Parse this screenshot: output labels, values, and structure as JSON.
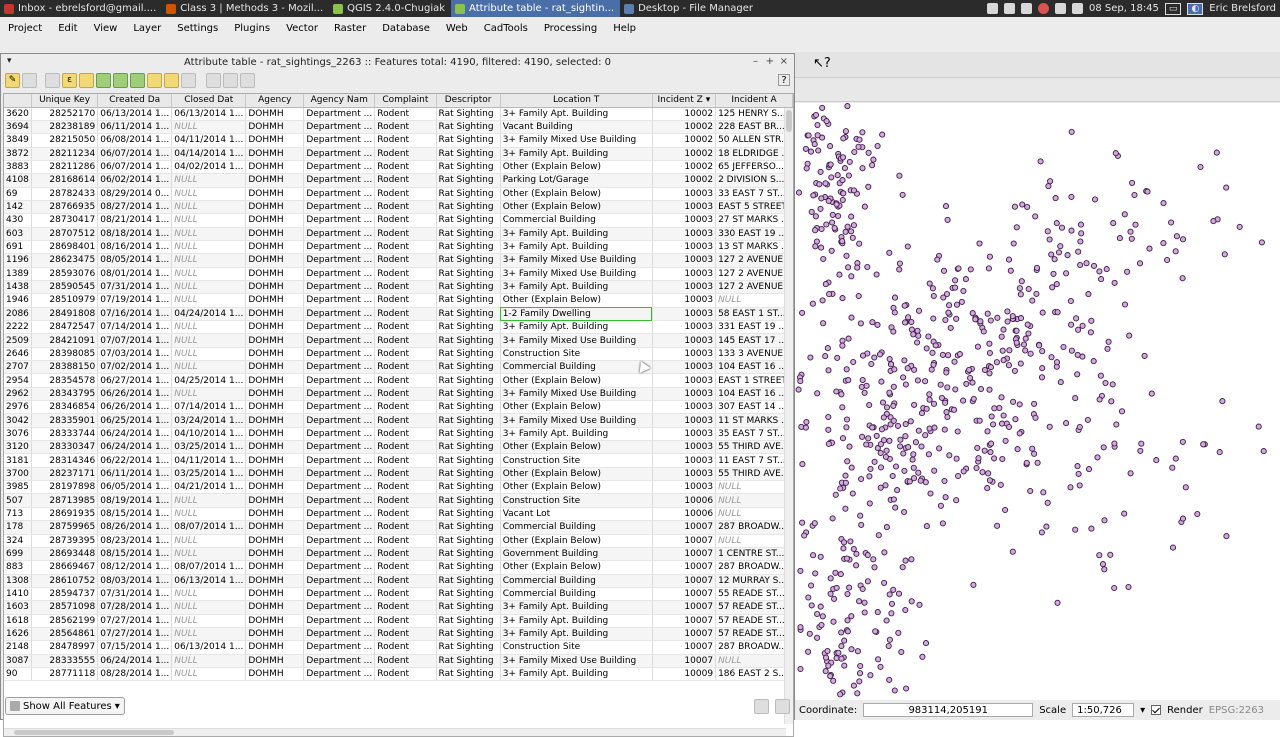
{
  "taskbar": {
    "tasks": [
      {
        "label": "Inbox - ebrelsford@gmail....",
        "color": "#c0392b"
      },
      {
        "label": "Class 3 | Methods 3 - Mozil...",
        "color": "#d35400"
      },
      {
        "label": "QGIS 2.4.0-Chugiak",
        "color": "#8bc34a"
      },
      {
        "label": "Attribute table - rat_sightin...",
        "color": "#8bc34a"
      },
      {
        "label": "Desktop - File Manager",
        "color": "#5b7fb0"
      }
    ],
    "clock": "08 Sep, 18:45",
    "user": "Eric Brelsford"
  },
  "menubar": [
    "Project",
    "Edit",
    "View",
    "Layer",
    "Settings",
    "Plugins",
    "Vector",
    "Raster",
    "Database",
    "Web",
    "CadTools",
    "Processing",
    "Help"
  ],
  "dialog": {
    "title": "Attribute table - rat_sightings_2263 :: Features total: 4190, filtered: 4190, selected: 0",
    "controls": {
      "minimize": "–",
      "maximize": "+",
      "close": "×",
      "help": "?"
    },
    "show_all_label": "Show All Features"
  },
  "table": {
    "columns": [
      "Unique Key",
      "Created Da",
      "Closed Dat",
      "Agency",
      "Agency Nam",
      "Complaint",
      "Descriptor",
      "Location T",
      "Incident Z",
      "Incident A"
    ],
    "rows": [
      [
        "3620",
        "28252170",
        "06/13/2014 1...",
        "06/13/2014 1...",
        "DOHMH",
        "Department ...",
        "Rodent",
        "Rat Sighting",
        "3+ Family Apt. Building",
        "10002",
        "125 HENRY S..."
      ],
      [
        "3694",
        "28238189",
        "06/11/2014 1...",
        "NULL",
        "DOHMH",
        "Department ...",
        "Rodent",
        "Rat Sighting",
        "Vacant Building",
        "10002",
        "228 EAST BR..."
      ],
      [
        "3849",
        "28215050",
        "06/08/2014 1...",
        "04/11/2014 1...",
        "DOHMH",
        "Department ...",
        "Rodent",
        "Rat Sighting",
        "3+ Family Mixed Use Building",
        "10002",
        "50 ALLEN STR..."
      ],
      [
        "3872",
        "28211234",
        "06/07/2014 1...",
        "04/14/2014 1...",
        "DOHMH",
        "Department ...",
        "Rodent",
        "Rat Sighting",
        "3+ Family Apt. Building",
        "10002",
        "18 ELDRIDGE ..."
      ],
      [
        "3883",
        "28211286",
        "06/07/2014 1...",
        "04/02/2014 1...",
        "DOHMH",
        "Department ...",
        "Rodent",
        "Rat Sighting",
        "Other (Explain Below)",
        "10002",
        "65 JEFFERSO..."
      ],
      [
        "4108",
        "28168614",
        "06/02/2014 1...",
        "NULL",
        "DOHMH",
        "Department ...",
        "Rodent",
        "Rat Sighting",
        "Parking Lot/Garage",
        "10002",
        "2 DIVISION S..."
      ],
      [
        "69",
        "28782433",
        "08/29/2014 0...",
        "NULL",
        "DOHMH",
        "Department ...",
        "Rodent",
        "Rat Sighting",
        "Other (Explain Below)",
        "10003",
        "33 EAST 7 ST..."
      ],
      [
        "142",
        "28766935",
        "08/27/2014 1...",
        "NULL",
        "DOHMH",
        "Department ...",
        "Rodent",
        "Rat Sighting",
        "Other (Explain Below)",
        "10003",
        "EAST 5 STREET"
      ],
      [
        "430",
        "28730417",
        "08/21/2014 1...",
        "NULL",
        "DOHMH",
        "Department ...",
        "Rodent",
        "Rat Sighting",
        "Commercial Building",
        "10003",
        "27 ST MARKS ..."
      ],
      [
        "603",
        "28707512",
        "08/18/2014 1...",
        "NULL",
        "DOHMH",
        "Department ...",
        "Rodent",
        "Rat Sighting",
        "3+ Family Apt. Building",
        "10003",
        "330 EAST 19 ..."
      ],
      [
        "691",
        "28698401",
        "08/16/2014 1...",
        "NULL",
        "DOHMH",
        "Department ...",
        "Rodent",
        "Rat Sighting",
        "3+ Family Apt. Building",
        "10003",
        "13 ST MARKS ..."
      ],
      [
        "1196",
        "28623475",
        "08/05/2014 1...",
        "NULL",
        "DOHMH",
        "Department ...",
        "Rodent",
        "Rat Sighting",
        "3+ Family Mixed Use Building",
        "10003",
        "127 2 AVENUE"
      ],
      [
        "1389",
        "28593076",
        "08/01/2014 1...",
        "NULL",
        "DOHMH",
        "Department ...",
        "Rodent",
        "Rat Sighting",
        "3+ Family Mixed Use Building",
        "10003",
        "127 2 AVENUE"
      ],
      [
        "1438",
        "28590545",
        "07/31/2014 1...",
        "NULL",
        "DOHMH",
        "Department ...",
        "Rodent",
        "Rat Sighting",
        "3+ Family Apt. Building",
        "10003",
        "127 2 AVENUE"
      ],
      [
        "1946",
        "28510979",
        "07/19/2014 1...",
        "NULL",
        "DOHMH",
        "Department ...",
        "Rodent",
        "Rat Sighting",
        "Other (Explain Below)",
        "10003",
        "NULL"
      ],
      [
        "2086",
        "28491808",
        "07/16/2014 1...",
        "04/24/2014 1...",
        "DOHMH",
        "Department ...",
        "Rodent",
        "Rat Sighting",
        "1-2 Family Dwelling",
        "10003",
        "58 EAST 1 ST..."
      ],
      [
        "2222",
        "28472547",
        "07/14/2014 1...",
        "NULL",
        "DOHMH",
        "Department ...",
        "Rodent",
        "Rat Sighting",
        "3+ Family Apt. Building",
        "10003",
        "331 EAST 19 ..."
      ],
      [
        "2509",
        "28421091",
        "07/07/2014 1...",
        "NULL",
        "DOHMH",
        "Department ...",
        "Rodent",
        "Rat Sighting",
        "3+ Family Mixed Use Building",
        "10003",
        "145 EAST 17 ..."
      ],
      [
        "2646",
        "28398085",
        "07/03/2014 1...",
        "NULL",
        "DOHMH",
        "Department ...",
        "Rodent",
        "Rat Sighting",
        "Construction Site",
        "10003",
        "133 3 AVENUE"
      ],
      [
        "2707",
        "28388150",
        "07/02/2014 1...",
        "NULL",
        "DOHMH",
        "Department ...",
        "Rodent",
        "Rat Sighting",
        "Commercial Building",
        "10003",
        "104 EAST 16 ..."
      ],
      [
        "2954",
        "28354578",
        "06/27/2014 1...",
        "04/25/2014 1...",
        "DOHMH",
        "Department ...",
        "Rodent",
        "Rat Sighting",
        "Other (Explain Below)",
        "10003",
        "EAST 1 STREET"
      ],
      [
        "2962",
        "28343795",
        "06/26/2014 1...",
        "NULL",
        "DOHMH",
        "Department ...",
        "Rodent",
        "Rat Sighting",
        "3+ Family Mixed Use Building",
        "10003",
        "104 EAST 16 ..."
      ],
      [
        "2976",
        "28346854",
        "06/26/2014 1...",
        "07/14/2014 1...",
        "DOHMH",
        "Department ...",
        "Rodent",
        "Rat Sighting",
        "Other (Explain Below)",
        "10003",
        "307 EAST 14 ..."
      ],
      [
        "3042",
        "28335901",
        "06/25/2014 1...",
        "03/24/2014 1...",
        "DOHMH",
        "Department ...",
        "Rodent",
        "Rat Sighting",
        "3+ Family Mixed Use Building",
        "10003",
        "11 ST MARKS ..."
      ],
      [
        "3076",
        "28333744",
        "06/24/2014 1...",
        "04/10/2014 1...",
        "DOHMH",
        "Department ...",
        "Rodent",
        "Rat Sighting",
        "3+ Family Apt. Building",
        "10003",
        "35 EAST 7 ST..."
      ],
      [
        "3120",
        "28330347",
        "06/24/2014 1...",
        "03/25/2014 1...",
        "DOHMH",
        "Department ...",
        "Rodent",
        "Rat Sighting",
        "Other (Explain Below)",
        "10003",
        "55 THIRD AVE..."
      ],
      [
        "3181",
        "28314346",
        "06/22/2014 1...",
        "04/11/2014 1...",
        "DOHMH",
        "Department ...",
        "Rodent",
        "Rat Sighting",
        "Construction Site",
        "10003",
        "11 EAST 7 ST..."
      ],
      [
        "3700",
        "28237171",
        "06/11/2014 1...",
        "03/25/2014 1...",
        "DOHMH",
        "Department ...",
        "Rodent",
        "Rat Sighting",
        "Other (Explain Below)",
        "10003",
        "55 THIRD AVE..."
      ],
      [
        "3985",
        "28197898",
        "06/05/2014 1...",
        "04/21/2014 1...",
        "DOHMH",
        "Department ...",
        "Rodent",
        "Rat Sighting",
        "Other (Explain Below)",
        "10003",
        "NULL"
      ],
      [
        "507",
        "28713985",
        "08/19/2014 1...",
        "NULL",
        "DOHMH",
        "Department ...",
        "Rodent",
        "Rat Sighting",
        "Construction Site",
        "10006",
        "NULL"
      ],
      [
        "713",
        "28691935",
        "08/15/2014 1...",
        "NULL",
        "DOHMH",
        "Department ...",
        "Rodent",
        "Rat Sighting",
        "Vacant Lot",
        "10006",
        "NULL"
      ],
      [
        "178",
        "28759965",
        "08/26/2014 1...",
        "08/07/2014 1...",
        "DOHMH",
        "Department ...",
        "Rodent",
        "Rat Sighting",
        "Commercial Building",
        "10007",
        "287 BROADW..."
      ],
      [
        "324",
        "28739395",
        "08/23/2014 1...",
        "NULL",
        "DOHMH",
        "Department ...",
        "Rodent",
        "Rat Sighting",
        "Other (Explain Below)",
        "10007",
        "NULL"
      ],
      [
        "699",
        "28693448",
        "08/15/2014 1...",
        "NULL",
        "DOHMH",
        "Department ...",
        "Rodent",
        "Rat Sighting",
        "Government Building",
        "10007",
        "1 CENTRE ST..."
      ],
      [
        "883",
        "28669467",
        "08/12/2014 1...",
        "08/07/2014 1...",
        "DOHMH",
        "Department ...",
        "Rodent",
        "Rat Sighting",
        "Other (Explain Below)",
        "10007",
        "287 BROADW..."
      ],
      [
        "1308",
        "28610752",
        "08/03/2014 1...",
        "06/13/2014 1...",
        "DOHMH",
        "Department ...",
        "Rodent",
        "Rat Sighting",
        "Commercial Building",
        "10007",
        "12 MURRAY S..."
      ],
      [
        "1410",
        "28594737",
        "07/31/2014 1...",
        "NULL",
        "DOHMH",
        "Department ...",
        "Rodent",
        "Rat Sighting",
        "Commercial Building",
        "10007",
        "55 READE ST..."
      ],
      [
        "1603",
        "28571098",
        "07/28/2014 1...",
        "NULL",
        "DOHMH",
        "Department ...",
        "Rodent",
        "Rat Sighting",
        "3+ Family Apt. Building",
        "10007",
        "57 READE ST..."
      ],
      [
        "1618",
        "28562199",
        "07/27/2014 1...",
        "NULL",
        "DOHMH",
        "Department ...",
        "Rodent",
        "Rat Sighting",
        "3+ Family Apt. Building",
        "10007",
        "57 READE ST..."
      ],
      [
        "1626",
        "28564861",
        "07/27/2014 1...",
        "NULL",
        "DOHMH",
        "Department ...",
        "Rodent",
        "Rat Sighting",
        "3+ Family Apt. Building",
        "10007",
        "57 READE ST..."
      ],
      [
        "2148",
        "28478997",
        "07/15/2014 1...",
        "06/13/2014 1...",
        "DOHMH",
        "Department ...",
        "Rodent",
        "Rat Sighting",
        "Construction Site",
        "10007",
        "287 BROADW..."
      ],
      [
        "3087",
        "28333555",
        "06/24/2014 1...",
        "NULL",
        "DOHMH",
        "Department ...",
        "Rodent",
        "Rat Sighting",
        "3+ Family Mixed Use Building",
        "10007",
        "NULL"
      ],
      [
        "90",
        "28771118",
        "08/28/2014 1...",
        "NULL",
        "DOHMH",
        "Department ...",
        "Rodent",
        "Rat Sighting",
        "3+ Family Apt. Building",
        "10009",
        "186 EAST 2 S..."
      ]
    ],
    "selected_cell": {
      "row": 15,
      "col": 8
    }
  },
  "map": {
    "point_color": "#d6a8e0",
    "stroke_color": "#3a1f45"
  },
  "status": {
    "coord_label": "Coordinate:",
    "coord_value": "983114,205191",
    "scale_label": "Scale",
    "scale_value": "1:50,726",
    "render_label": "Render",
    "crs": "EPSG:2263"
  },
  "colors": {
    "selection_outline": "#2fbf2f",
    "active_task": "#4a6fa8"
  }
}
